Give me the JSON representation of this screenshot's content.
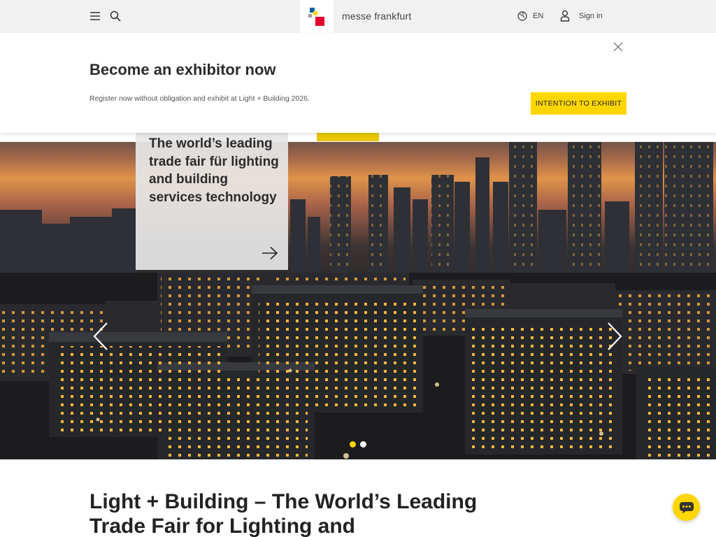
{
  "header": {
    "brand": "messe frankfurt",
    "language": "EN",
    "sign_in": "Sign in",
    "icons": [
      "menu-icon",
      "search-icon",
      "globe-icon",
      "user-icon"
    ]
  },
  "banner": {
    "title": "Become an exhibitor now",
    "text": "Register now without obligation and exhibit at Light + Building 2026.",
    "cta": "INTENTION TO EXHIBIT"
  },
  "hero": {
    "card_title": "The world’s leading trade fair für lighting and building services technology",
    "slides": 2,
    "active_slide": 1
  },
  "main": {
    "title": "Light + Building – The World’s Leading Trade Fair for Lighting and"
  },
  "colors": {
    "accent": "#ffd600",
    "header_bg": "#f1f1f1",
    "logo_red": "#e4002b",
    "logo_blue": "#0060a9"
  }
}
